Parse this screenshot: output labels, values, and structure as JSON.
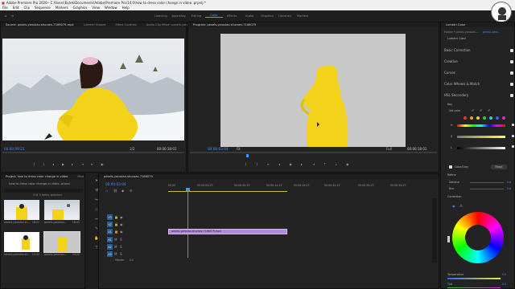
{
  "window": {
    "title": "Adobe Premiere Pro 2020 - C:\\Users\\Evtek\\Documents\\Adobe\\Premiere Pro\\14.0\\how to dress color change in video .prproj *"
  },
  "menu": [
    "File",
    "Edit",
    "Clip",
    "Sequence",
    "Markers",
    "Graphics",
    "View",
    "Window",
    "Help"
  ],
  "workspaces": [
    {
      "label": "Learning",
      "active": false
    },
    {
      "label": "Assembly",
      "active": false
    },
    {
      "label": "Editing",
      "active": false
    },
    {
      "label": "Color",
      "active": true
    },
    {
      "label": "Effects",
      "active": false
    },
    {
      "label": "Audio",
      "active": false
    },
    {
      "label": "Graphics",
      "active": false
    },
    {
      "label": "Libraries",
      "active": false
    },
    {
      "label": "Markers",
      "active": false
    }
  ],
  "source_panel": {
    "tabs": [
      "Source: pexels-yaroslav-shuraev-7166079.mp4",
      "Lumetri Scopes",
      "Effect Controls",
      "Audio Clip Mixer: pexels-yaro"
    ],
    "timecode": "00:00:09:21",
    "fit": "1/2",
    "duration": "00:00:18:01"
  },
  "program_panel": {
    "tabs": [
      "Program: pexels-yaroslav-shuraev-7166079"
    ],
    "timecode": "00:00:03:04",
    "fit": "Fit",
    "quality": "Full",
    "duration": "00:00:18:01"
  },
  "project_panel": {
    "tabs": [
      "Project: how to dress color change in video",
      "Med"
    ],
    "file": "how to dress color change in video .prproj",
    "count": "4 of 5 items selected",
    "items": [
      {
        "name": "pexels-yaroslav-sh...",
        "dur": "18:01"
      },
      {
        "name": "pexels-yaroslav...",
        "dur": "18:01"
      },
      {
        "name": "pexels-yaroslav-sh...",
        "dur": "14:22"
      },
      {
        "name": "pexels-yaroslav...",
        "dur": "14:22"
      }
    ]
  },
  "timeline": {
    "tab": "pexels-yaroslav-shuraev-7166079",
    "timecode": "00:00:03:04",
    "ruler": [
      "00:00",
      "00:00:04:23",
      "00:00:09:23",
      "00:00:14:23",
      "00:00:19:23",
      "00:00:24:23",
      "00:00:29:23",
      "00:00:34:23"
    ],
    "tracks": [
      "V3",
      "V2",
      "V1",
      "A1",
      "A2",
      "A3"
    ],
    "master_label": "Master",
    "master_value": "0.0",
    "clip_label": "pexels-yaroslav-shuraev-7166079.mp4"
  },
  "lumetri": {
    "tab": "Lumetri Color",
    "master": "Master * pexels-yaroslav-...",
    "clip": "pexels-yaro...",
    "effect": "Lumetri Color",
    "sections": [
      "Basic Correction",
      "Creative",
      "Curves",
      "Color Wheels & Match",
      "HSL Secondary"
    ],
    "key_label": "Key",
    "set_color_label": "Set color",
    "hsl_letters": [
      "H",
      "S",
      "L"
    ],
    "color_gray_label": "Color/Gray",
    "reset_label": "Reset",
    "refine_label": "Refine",
    "denoise_label": "Denoise",
    "blur_label": "Blur",
    "denoise_value": "0.0",
    "blur_value": "0.0",
    "correction_label": "Correction",
    "temperature_label": "Temperature",
    "temperature_value": "0.0",
    "tint_label": "Tint",
    "tint_value": "0.0"
  },
  "colors": {
    "accent": "#4a8fff",
    "clip_violet": "#b18ad8",
    "jacket_yellow": "#f3d21a"
  }
}
